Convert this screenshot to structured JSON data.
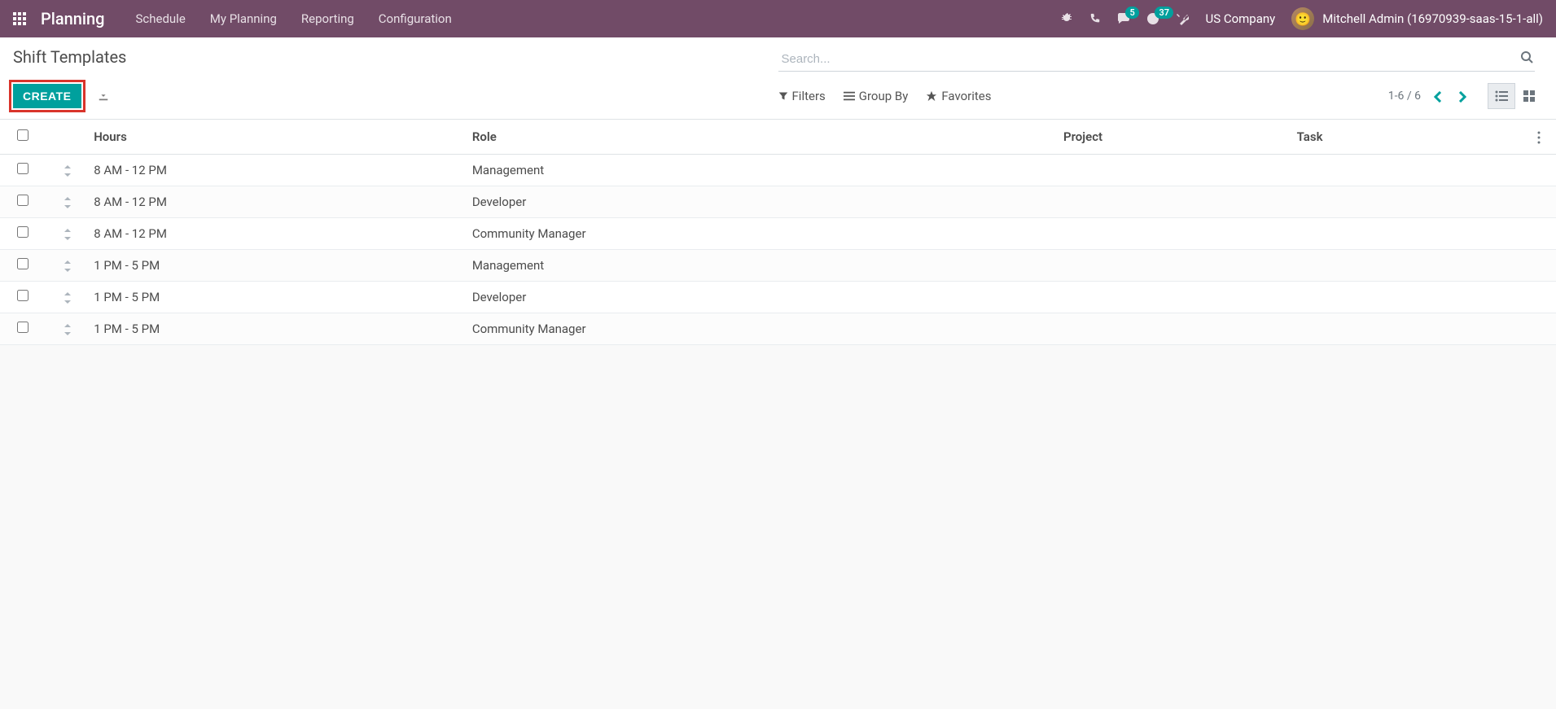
{
  "nav": {
    "app_title": "Planning",
    "menu": [
      "Schedule",
      "My Planning",
      "Reporting",
      "Configuration"
    ],
    "conversations_badge": "5",
    "activities_badge": "37",
    "company": "US Company",
    "user": "Mitchell Admin (16970939-saas-15-1-all)"
  },
  "cp": {
    "breadcrumb": "Shift Templates",
    "search_placeholder": "Search...",
    "create_label": "CREATE",
    "filters_label": "Filters",
    "groupby_label": "Group By",
    "favorites_label": "Favorites",
    "pager": "1-6 / 6"
  },
  "table": {
    "headers": {
      "hours": "Hours",
      "role": "Role",
      "project": "Project",
      "task": "Task"
    },
    "rows": [
      {
        "hours": "8 AM - 12 PM",
        "role": "Management",
        "project": "",
        "task": ""
      },
      {
        "hours": "8 AM - 12 PM",
        "role": "Developer",
        "project": "",
        "task": ""
      },
      {
        "hours": "8 AM - 12 PM",
        "role": "Community Manager",
        "project": "",
        "task": ""
      },
      {
        "hours": "1 PM - 5 PM",
        "role": "Management",
        "project": "",
        "task": ""
      },
      {
        "hours": "1 PM - 5 PM",
        "role": "Developer",
        "project": "",
        "task": ""
      },
      {
        "hours": "1 PM - 5 PM",
        "role": "Community Manager",
        "project": "",
        "task": ""
      }
    ]
  }
}
